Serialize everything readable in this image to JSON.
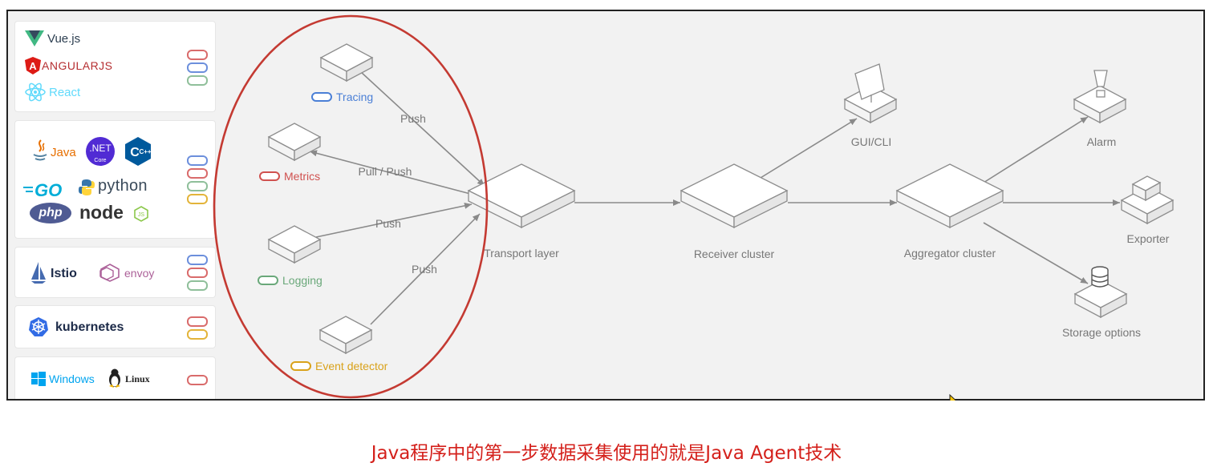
{
  "sidebar": {
    "frontend": [
      "Vue.js",
      "ANGULARJS",
      "React"
    ],
    "backend": {
      "java": "Java",
      "dotnet": ".NET",
      "dotnet_sub": "Core",
      "cpp": "C++",
      "go": "GO",
      "python": "python",
      "php": "php",
      "node": "node"
    },
    "mesh": [
      "Istio",
      "envoy"
    ],
    "orchestration": "kubernetes",
    "os": [
      "Windows",
      "Linux"
    ]
  },
  "diagram": {
    "sources": {
      "tracing": "Tracing",
      "metrics": "Metrics",
      "logging": "Logging",
      "event": "Event detector"
    },
    "edges": {
      "push1": "Push",
      "pullpush": "Pull / Push",
      "push2": "Push",
      "push3": "Push"
    },
    "nodes": {
      "transport": "Transport layer",
      "receiver": "Receiver cluster",
      "aggregator": "Aggregator cluster",
      "gui": "GUI/CLI",
      "alarm": "Alarm",
      "exporter": "Exporter",
      "storage": "Storage options"
    }
  },
  "caption": "Java程序中的第一步数据采集使用的就是Java Agent技术",
  "colors": {
    "tracing": "#4a7fd6",
    "metrics": "#d0514f",
    "logging": "#6aa87a",
    "event": "#d9a21a",
    "highlight_ellipse": "#c43a32",
    "caption": "#d4201b"
  }
}
